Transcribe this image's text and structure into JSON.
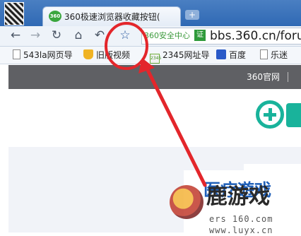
{
  "tab": {
    "icon_label": "360",
    "title": "360极速浏览器收藏按钮(",
    "new_tab_glyph": "+"
  },
  "toolbar": {
    "back_glyph": "←",
    "forward_glyph": "→",
    "reload_glyph": "↻",
    "home_glyph": "⌂",
    "undo_glyph": "↶",
    "star_glyph": "☆"
  },
  "address": {
    "security_label": "360安全中心",
    "security_badge": "证",
    "url": "bbs.360.cn/foru"
  },
  "bookmarks": [
    {
      "label": "543la网页导",
      "icon": "document-icon"
    },
    {
      "label": "旧版视频",
      "icon": "trophy-icon"
    },
    {
      "label": "2345网址导",
      "icon": "2345-icon"
    },
    {
      "label": "百度",
      "icon": "paw-icon"
    },
    {
      "label": "乐迷",
      "icon": "document-icon"
    }
  ],
  "page": {
    "header_link": "360官网",
    "panel_title": "医疗遊戏"
  },
  "watermark": {
    "text": "鹿游戏",
    "url": "ers 160.com www.luyx.cn"
  },
  "colors": {
    "tab_strip": "#2f69b4",
    "header_bar": "#5f6064",
    "logo_teal": "#19b39b",
    "annotation_red": "#e3262b"
  }
}
